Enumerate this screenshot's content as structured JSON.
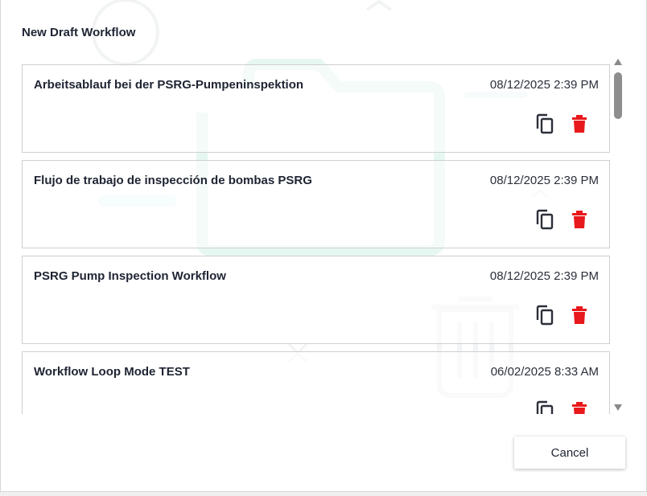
{
  "dialog": {
    "title": "New Draft Workflow",
    "cancel_label": "Cancel"
  },
  "workflows": [
    {
      "name": "Arbeitsablauf bei der PSRG-Pumpeninspektion",
      "date": "08/12/2025 2:39 PM"
    },
    {
      "name": "Flujo de trabajo de inspección de bombas PSRG",
      "date": "08/12/2025 2:39 PM"
    },
    {
      "name": "PSRG Pump Inspection Workflow",
      "date": "08/12/2025 2:39 PM"
    },
    {
      "name": "Workflow Loop Mode TEST",
      "date": "06/02/2025 8:33 AM"
    }
  ],
  "icons": {
    "copy": "copy-icon",
    "delete": "trash-icon",
    "scroll_up": "triangle-up-icon",
    "scroll_down": "triangle-down-icon"
  },
  "colors": {
    "text": "#1f2433",
    "delete": "#e8191c",
    "copy": "#2b2f3a",
    "scroll_thumb": "#8e8e8e",
    "watermark": "#e6f7f1"
  }
}
